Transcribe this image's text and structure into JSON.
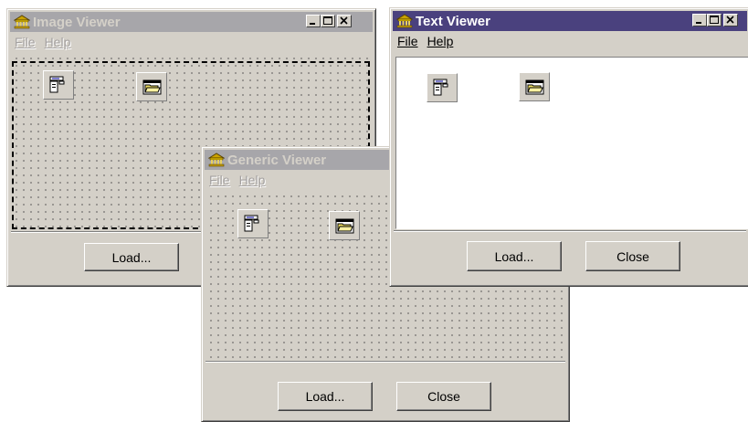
{
  "windows": {
    "image_viewer": {
      "title": "Image Viewer",
      "active": false,
      "menu": {
        "file": "File",
        "help": "Help"
      },
      "buttons": {
        "load": "Load..."
      }
    },
    "text_viewer": {
      "title": "Text Viewer",
      "active": true,
      "menu": {
        "file": "File",
        "help": "Help"
      },
      "buttons": {
        "load": "Load...",
        "close": "Close"
      }
    },
    "generic_viewer": {
      "title": "Generic Viewer",
      "active": false,
      "menu": {
        "file": "File",
        "help": "Help"
      },
      "buttons": {
        "load": "Load...",
        "close": "Close"
      }
    }
  },
  "icons": {
    "app": "museum-building-icon",
    "component_a": "text-document-component-icon",
    "component_b": "open-folder-icon",
    "minimize": "minimize-icon",
    "maximize": "maximize-icon",
    "close": "close-icon"
  },
  "colors": {
    "active_title": "#4a417e",
    "inactive_title": "#a7a6aa",
    "face": "#d4d0c8",
    "disabled_text": "#a4a1a0"
  }
}
